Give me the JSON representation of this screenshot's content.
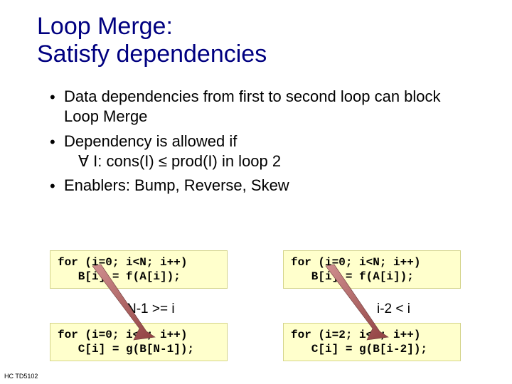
{
  "title_line1": "Loop Merge:",
  "title_line2": "Satisfy dependencies",
  "bullets": {
    "b1": "Data dependencies from first to second loop can block Loop Merge",
    "b2": "Dependency is allowed if",
    "b2sub": "∀ I: cons(I) ≤ prod(I) in loop 2",
    "b3": "Enablers: Bump, Reverse, Skew"
  },
  "code": {
    "left_top": "for (i=0; i<N; i++)\n   B[i] = f(A[i]);",
    "left_bot": "for (i=0; i<N; i++)\n   C[i] = g(B[N-1]);",
    "right_top": "for (i=0; i<N; i++)\n   B[i] = f(A[i]);",
    "right_bot": "for (i=2; i<N; i++)\n   C[i] = g(B[i-2]);"
  },
  "annot": {
    "left": "N-1 >= i",
    "right": "i-2 < i"
  },
  "footer": "HC  TD5102"
}
